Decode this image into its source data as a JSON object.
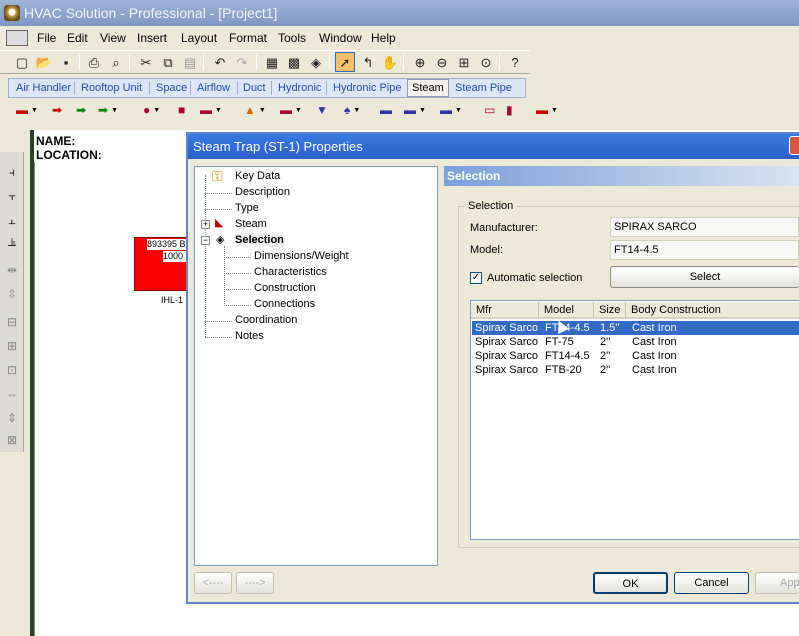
{
  "app": {
    "title": "HVAC Solution - Professional - [Project1]"
  },
  "menu": [
    "File",
    "Edit",
    "View",
    "Insert",
    "Layout",
    "Format",
    "Tools",
    "Window",
    "Help"
  ],
  "tabs": [
    "Air Handler",
    "Rooftop Unit",
    "Space",
    "Airflow",
    "Duct",
    "Hydronic",
    "Hydronic Pipe",
    "Steam",
    "Steam Pipe"
  ],
  "active_tab": "Steam",
  "canvas": {
    "name_label": "NAME:",
    "location_label": "LOCATION:",
    "equip_text1": "893395 B",
    "equip_text2": "1000",
    "equip_label": "IHL-1"
  },
  "dialog": {
    "title": "Steam Trap (ST-1) Properties",
    "tree": [
      "Key Data",
      "Description",
      "Type",
      "Steam",
      "Selection",
      "Dimensions/Weight",
      "Characteristics",
      "Construction",
      "Connections",
      "Coordination",
      "Notes"
    ],
    "panel_title": "Selection",
    "group_label": "Selection",
    "manufacturer_label": "Manufacturer:",
    "manufacturer_value": "SPIRAX SARCO",
    "model_label": "Model:",
    "model_value": "FT14-4.5",
    "auto_select_label": "Automatic selection",
    "select_button": "Select",
    "columns": [
      "Mfr",
      "Model",
      "Size",
      "Body Construction"
    ],
    "rows": [
      [
        "Spirax Sarco",
        "FT14-4.5",
        "1.5''",
        "Cast Iron"
      ],
      [
        "Spirax Sarco",
        "FT-75",
        "2''",
        "Cast Iron"
      ],
      [
        "Spirax Sarco",
        "FT14-4.5",
        "2''",
        "Cast Iron"
      ],
      [
        "Spirax Sarco",
        "FTB-20",
        "2''",
        "Cast Iron"
      ]
    ],
    "back_button": "<----",
    "forward_button": "---->",
    "ok_button": "OK",
    "cancel_button": "Cancel",
    "apply_button": "App"
  }
}
